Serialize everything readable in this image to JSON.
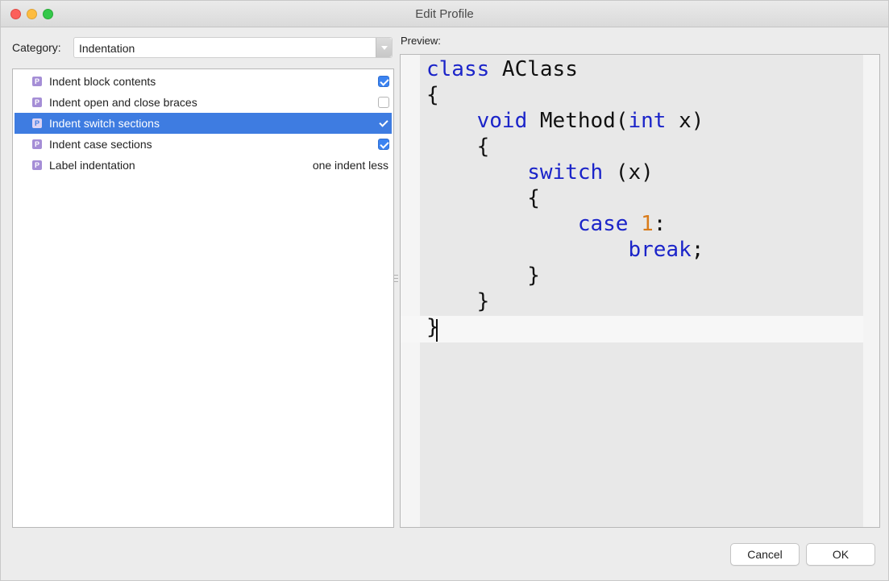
{
  "window": {
    "title": "Edit Profile"
  },
  "category": {
    "label": "Category:",
    "selected": "Indentation"
  },
  "options": [
    {
      "label": "Indent block contents",
      "type": "checkbox",
      "checked": true,
      "selected": false
    },
    {
      "label": "Indent open and close braces",
      "type": "checkbox",
      "checked": false,
      "selected": false
    },
    {
      "label": "Indent switch sections",
      "type": "checkbox",
      "checked": true,
      "selected": true
    },
    {
      "label": "Indent case sections",
      "type": "checkbox",
      "checked": true,
      "selected": false
    },
    {
      "label": "Label indentation",
      "type": "value",
      "value": "one indent less",
      "selected": false
    }
  ],
  "option_icon_letter": "P",
  "preview": {
    "label": "Preview:",
    "code": {
      "class_kw": "class",
      "class_name": " AClass",
      "open_brace": "{",
      "void_kw": "void",
      "method_sig": " Method(",
      "int_kw": "int",
      "param": " x)",
      "switch_kw": "switch",
      "switch_arg": " (x)",
      "case_kw": "case",
      "case_num": "1",
      "colon": ":",
      "break_kw": "break",
      "semicolon": ";",
      "close_brace": "}"
    }
  },
  "buttons": {
    "cancel": "Cancel",
    "ok": "OK"
  },
  "colors": {
    "selection": "#3e7ce1",
    "keyword": "#1b24c9",
    "number": "#d97b1a"
  }
}
